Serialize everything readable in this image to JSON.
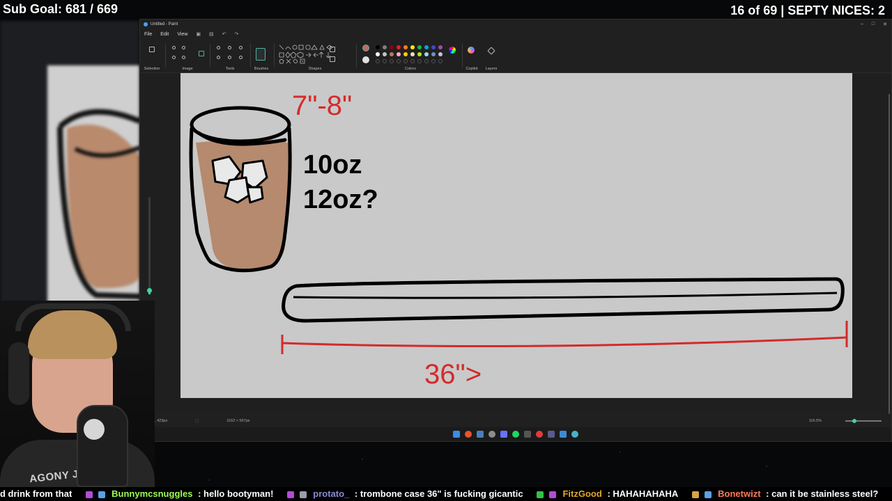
{
  "overlay": {
    "sub_goal": "Sub Goal: 681 / 669",
    "counter": "16 of 69 | SEPTY NICES: 2"
  },
  "paint": {
    "title": "Untitled - Paint",
    "menu": [
      "File",
      "Edit",
      "View"
    ],
    "ribbon_groups": [
      "Selection",
      "Image",
      "Tools",
      "Brushes",
      "Shapes",
      "Colors",
      "Copilot",
      "Layers"
    ],
    "status": {
      "cursor_pos": "196, 423px",
      "canvas_size": "1162 × 567px",
      "zoom": "116.5%"
    },
    "colors": [
      "#000000",
      "#7f7f7f",
      "#880015",
      "#ed1c24",
      "#ff7f27",
      "#fff200",
      "#22b14c",
      "#00a2e8",
      "#3f48cc",
      "#a349a4",
      "#ffffff",
      "#c3c3c3",
      "#b97a57",
      "#ffaec9",
      "#ffc90e",
      "#efe4b0",
      "#b5e61d",
      "#99d9ea",
      "#7092be",
      "#c8bfe7"
    ]
  },
  "canvas_drawing": {
    "height_annotation": "7\"-8\"",
    "volume_line1": "10oz",
    "volume_line2": "12oz?",
    "length_annotation": "36\">"
  },
  "webcam": {
    "shirt_text": "AGONY JU"
  },
  "chat": [
    {
      "user": "",
      "text": "d drink from that",
      "user_color": "#ffffff"
    },
    {
      "user": "Bunnymcsnuggles",
      "text": ": hello bootyman!",
      "user_color": "#9dff56"
    },
    {
      "user": "protato_",
      "text": ": trombone case 36\" is fucking gicantic",
      "user_color": "#8a8ad6"
    },
    {
      "user": "FitzGood",
      "text": ": HAHAHAHAHA",
      "user_color": "#e5a52a"
    },
    {
      "user": "Bonetwizt",
      "text": ": can it be stainless steel?",
      "user_color": "#ff7a5c"
    }
  ]
}
